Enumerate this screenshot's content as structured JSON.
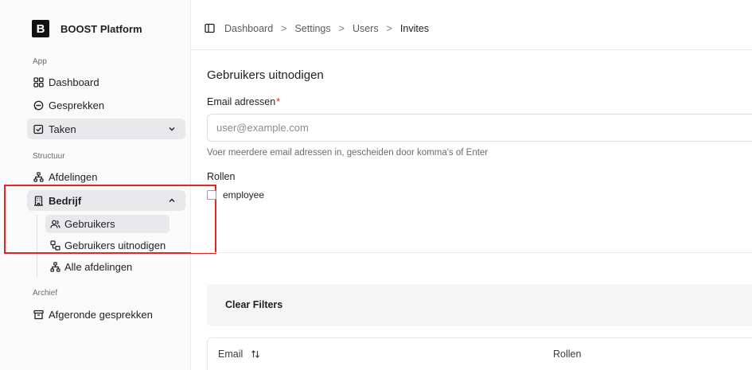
{
  "app": {
    "logo_letter": "B",
    "name": "BOOST Platform"
  },
  "sidebar": {
    "sections": {
      "app": "App",
      "structuur": "Structuur",
      "archief": "Archief"
    },
    "items": {
      "dashboard": "Dashboard",
      "gesprekken": "Gesprekken",
      "taken": "Taken",
      "afdelingen": "Afdelingen",
      "bedrijf": "Bedrijf",
      "gebruikers": "Gebruikers",
      "gebruikers_uitnodigen": "Gebruikers uitnodigen",
      "alle_afdelingen": "Alle afdelingen",
      "afgeronde_gesprekken": "Afgeronde gesprekken"
    }
  },
  "breadcrumb": [
    "Dashboard",
    "Settings",
    "Users",
    "Invites"
  ],
  "form": {
    "title": "Gebruikers uitnodigen",
    "email_label": "Email adressen",
    "required_mark": "*",
    "email_placeholder": "user@example.com",
    "email_value": "",
    "helper": "Voer meerdere email adressen in, gescheiden door komma's of Enter",
    "roles_label": "Rollen",
    "roles": [
      {
        "label": "employee",
        "checked": false
      }
    ]
  },
  "filters": {
    "clear_label": "Clear Filters"
  },
  "table": {
    "columns": [
      "Email",
      "Rollen"
    ]
  },
  "colors": {
    "highlight": "#e0262a",
    "active_bg": "#e9e9eb"
  }
}
